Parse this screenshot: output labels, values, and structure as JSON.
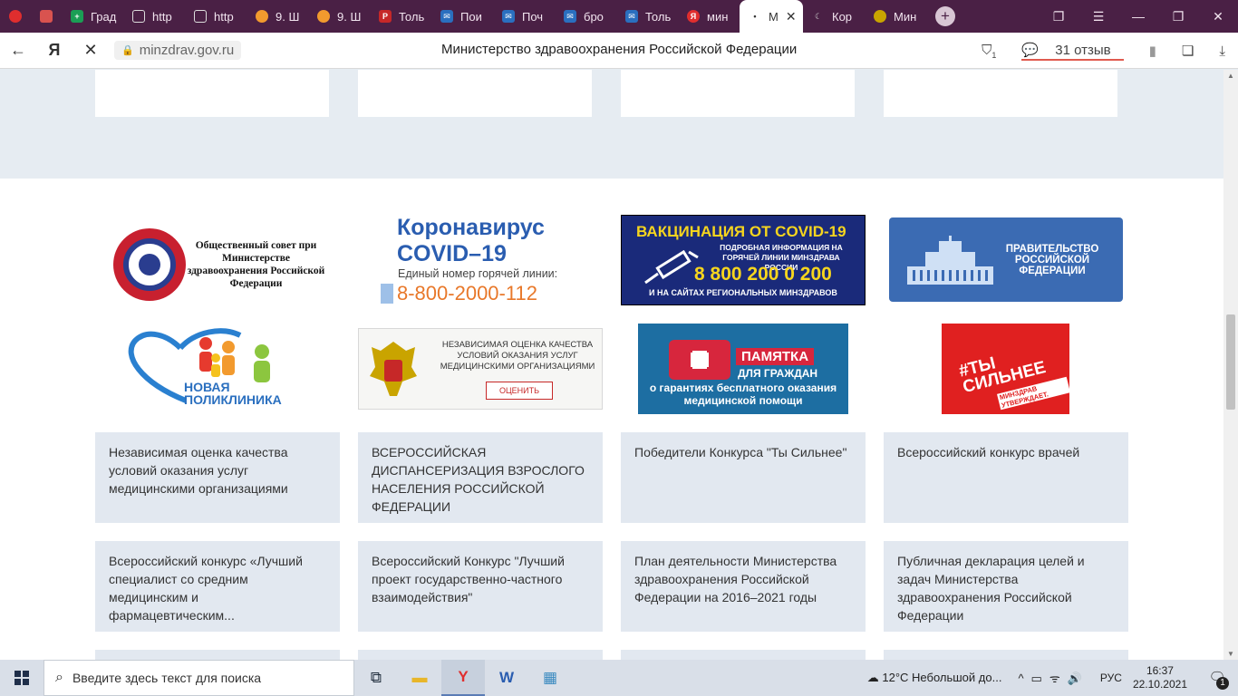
{
  "browser": {
    "tabs": [
      {
        "label": "",
        "icon": "yandex-circle-icon",
        "color": "#e02e2e"
      },
      {
        "label": "",
        "icon": "mail-icon",
        "color": "#d9534f"
      },
      {
        "label": "Град",
        "icon": "sheets-icon",
        "color": "#1b9e55"
      },
      {
        "label": "http",
        "icon": "page-icon",
        "color": "#777777"
      },
      {
        "label": "http",
        "icon": "page-icon",
        "color": "#777777"
      },
      {
        "label": "9. Ш",
        "icon": "cloud-icon",
        "color": "#f29a2e"
      },
      {
        "label": "9. Ш",
        "icon": "cloud-icon",
        "color": "#f29a2e"
      },
      {
        "label": "Толь",
        "icon": "pdf-icon",
        "color": "#c62828"
      },
      {
        "label": "Пои",
        "icon": "mail-icon",
        "color": "#2a6fbf"
      },
      {
        "label": "Поч",
        "icon": "mail-icon",
        "color": "#2a6fbf"
      },
      {
        "label": "бро",
        "icon": "mail-icon",
        "color": "#2a6fbf"
      },
      {
        "label": "Толь",
        "icon": "mail-icon",
        "color": "#2a6fbf"
      },
      {
        "label": "мин",
        "icon": "yandex-icon",
        "color": "#e02e2e"
      },
      {
        "label": "М",
        "icon": "loading-icon",
        "color": "#333333",
        "active": true
      },
      {
        "label": "Кор",
        "icon": "moon-icon",
        "color": "#999999"
      },
      {
        "label": "Мин",
        "icon": "emblem-icon",
        "color": "#c9a400"
      }
    ],
    "url": "minzdrav.gov.ru",
    "page_title": "Министерство здравоохранения Российской Федерации",
    "reviews": "31 отзыв",
    "shield_badge": "1"
  },
  "banners": {
    "council": "Общественный совет при Министерстве здравоохранения Российской Федерации",
    "covid_title_1": "Коронавирус",
    "covid_title_2": "COVID–19",
    "covid_sub": "Единый номер горячей линии:",
    "covid_phone": "8-800-2000-112",
    "vacc_title": "ВАКЦИНАЦИЯ ОТ COVID-19",
    "vacc_desc": "ПОДРОБНАЯ ИНФОРМАЦИЯ НА ГОРЯЧЕЙ ЛИНИИ МИНЗДРАВА РОССИИ",
    "vacc_phone": "8 800 200 0 200",
    "vacc_bottom": "И НА САЙТАХ РЕГИОНАЛЬНЫХ МИНЗДРАВОВ",
    "gov": "ПРАВИТЕЛЬСТВО РОССИЙСКОЙ ФЕДЕРАЦИИ",
    "poly_1": "НОВАЯ",
    "poly_2": "ПОЛИКЛИНИКА",
    "nezav": "НЕЗАВИСИМАЯ ОЦЕНКА КАЧЕСТВА УСЛОВИЙ ОКАЗАНИЯ УСЛУГ МЕДИЦИНСКИМИ ОРГАНИЗАЦИЯМИ",
    "nezav_btn": "ОЦЕНИТЬ",
    "pam_label": "ПАМЯТКА",
    "pam_sub": "ДЛЯ ГРАЖДАН",
    "pam_desc": "о гарантиях бесплатного оказания медицинской помощи",
    "sil": "#ТЫ СИЛЬНЕЕ",
    "sil_sub": "МИНЗДРАВ УТВЕРЖДАЕТ."
  },
  "cards": [
    "Независимая оценка качества условий оказания услуг медицинскими организациями",
    "ВСЕРОССИЙСКАЯ ДИСПАНСЕРИЗАЦИЯ ВЗРОСЛОГО НАСЕЛЕНИЯ РОССИЙСКОЙ ФЕДЕРАЦИИ",
    "Победители Конкурса \"Ты Сильнее\"",
    "Всероссийский конкурс врачей",
    "Всероссийский конкурс «Лучший специалист со средним медицинским и фармацевтическим...",
    "Всероссийский Конкурс \"Лучший проект государственно-частного взаимодействия\"",
    "План деятельности Министерства здравоохранения Российской Федерации на 2016–2021 годы",
    "Публичная декларация целей и задач Министерства здравоохранения Российской Федерации"
  ],
  "taskbar": {
    "search_placeholder": "Введите здесь текст для поиска",
    "weather": "12°C  Небольшой до...",
    "lang": "РУС",
    "time": "16:37",
    "date": "22.10.2021",
    "notifications": "1"
  }
}
